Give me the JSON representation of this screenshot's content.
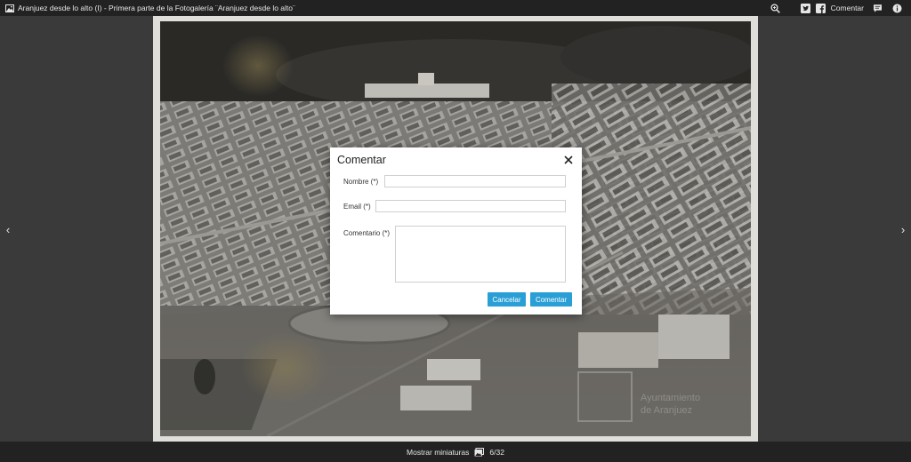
{
  "topbar": {
    "title": "Aranjuez desde lo alto (I) - Primera parte de la Fotogalería ¨Aranjuez desde lo alto¨",
    "comment_label": "Comentar",
    "icons": [
      "photo-icon",
      "zoom-icon",
      "twitter-icon",
      "facebook-icon",
      "comment-icon",
      "info-icon"
    ]
  },
  "navigation": {
    "prev_glyph": "‹",
    "next_glyph": "›"
  },
  "photo": {
    "watermark_line1": "Ayuntamiento",
    "watermark_line2": "de Aranjuez"
  },
  "modal": {
    "title": "Comentar",
    "name_label": "Nombre (*)",
    "email_label": "Email (*)",
    "comment_label": "Comentario (*)",
    "name_value": "",
    "email_value": "",
    "comment_value": "",
    "cancel_label": "Cancelar",
    "submit_label": "Comentar"
  },
  "bottombar": {
    "thumbnails_label": "Mostrar miniaturas",
    "counter": "6/32"
  },
  "colors": {
    "bar_bg": "#222222",
    "stage_bg": "#3a3a3a",
    "accent": "#2a9fd6"
  }
}
